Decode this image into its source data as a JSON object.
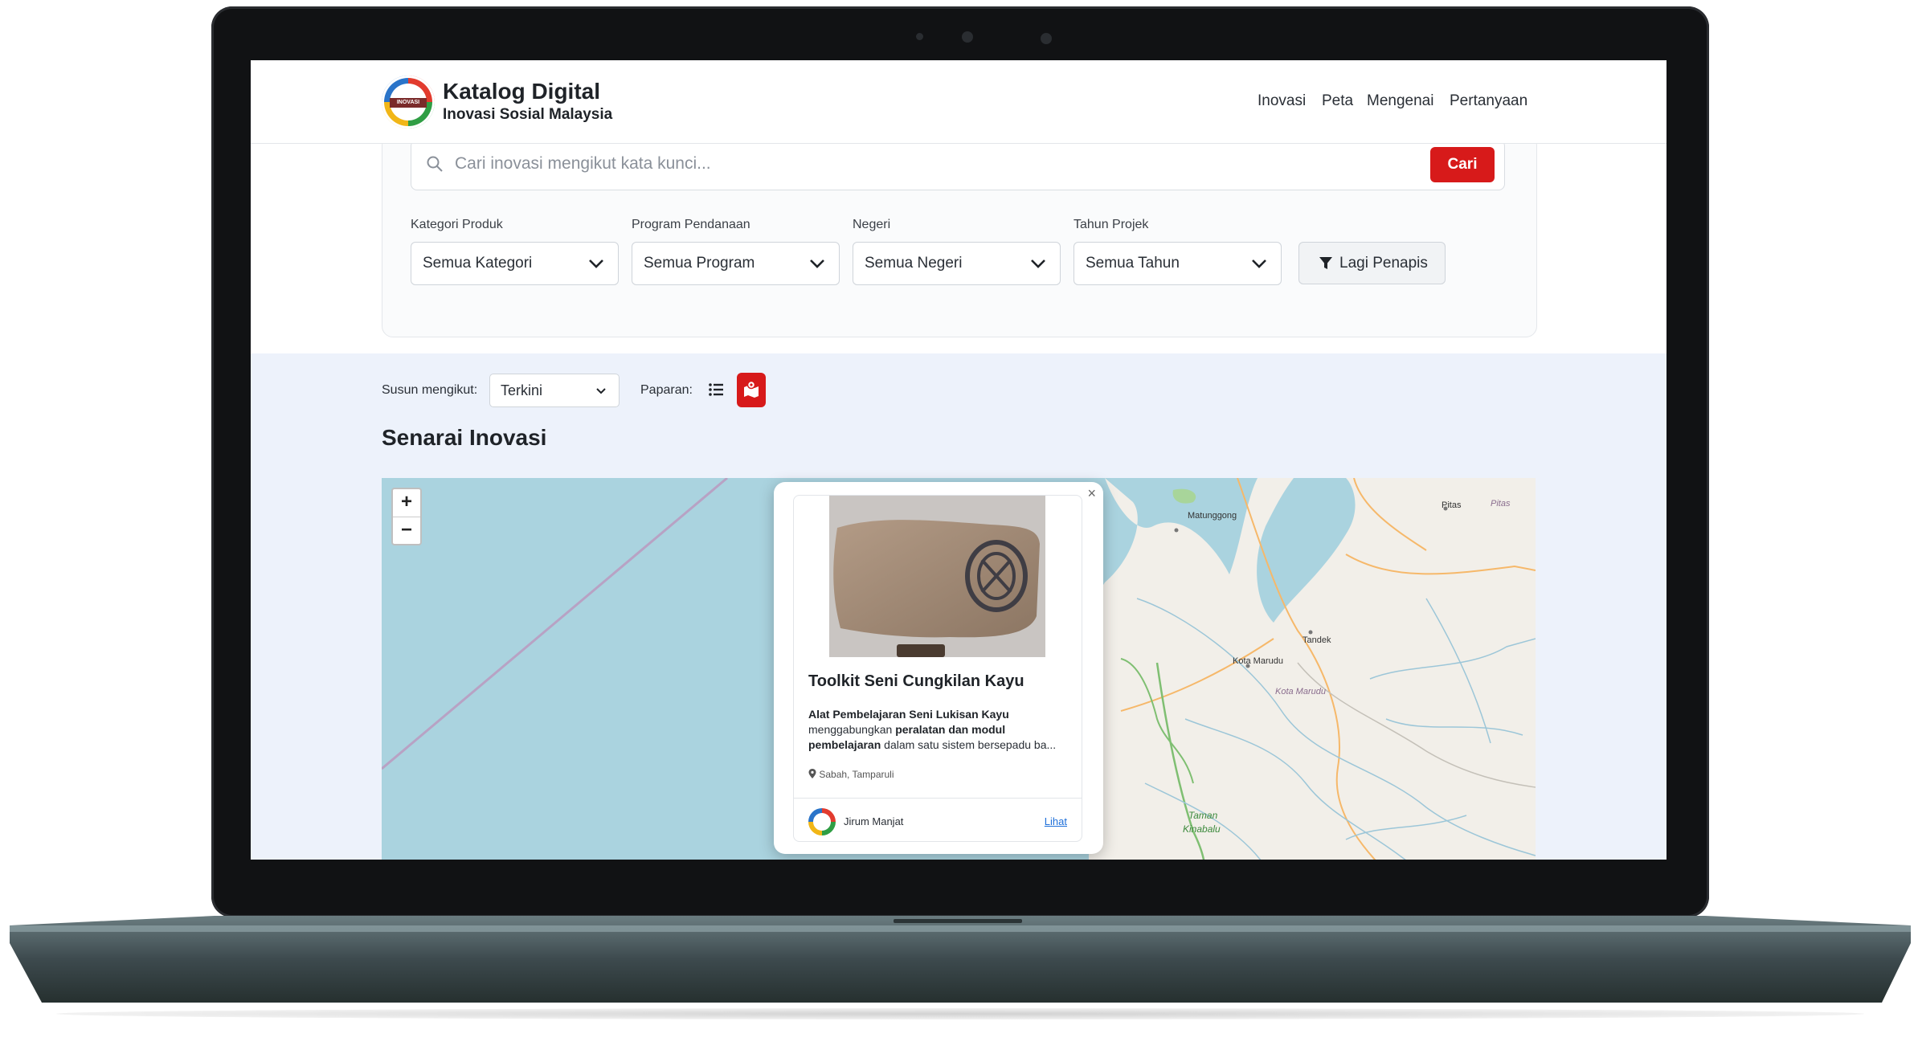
{
  "brand": {
    "title": "Katalog Digital",
    "subtitle": "Inovasi Sosial Malaysia",
    "logo_text": "INOVASI"
  },
  "nav": [
    "Inovasi",
    "Peta",
    "Mengenai",
    "Pertanyaan"
  ],
  "search": {
    "placeholder": "Cari inovasi mengikut kata kunci...",
    "button": "Cari"
  },
  "filters": [
    {
      "label": "Kategori Produk",
      "value": "Semua Kategori"
    },
    {
      "label": "Program Pendanaan",
      "value": "Semua Program"
    },
    {
      "label": "Negeri",
      "value": "Semua Negeri"
    },
    {
      "label": "Tahun Projek",
      "value": "Semua Tahun"
    }
  ],
  "more_filters": "Lagi Penapis",
  "sort": {
    "label": "Susun mengikut:",
    "value": "Terkini"
  },
  "view": {
    "label": "Paparan:"
  },
  "section_title": "Senarai Inovasi",
  "map": {
    "zoom_in": "+",
    "zoom_out": "−",
    "places": [
      "Matunggong",
      "Pitas",
      "Pitas",
      "Tandek",
      "Kota Marudu",
      "Kota Marudu",
      "Taman",
      "Kinabalu"
    ]
  },
  "popup": {
    "close": "×",
    "title": "Toolkit Seni Cungkilan Kayu",
    "desc_bold1": "Alat Pembelajaran Seni Lukisan Kayu",
    "desc_text1": " menggabungkan ",
    "desc_bold2": "peralatan dan modul pembelajaran",
    "desc_text2": " dalam satu sistem bersepadu ba...",
    "location": "Sabah, Tamparuli",
    "author": "Jirum Manjat",
    "link": "Lihat"
  },
  "colors": {
    "accent": "#d71a1a",
    "water": "#aad3df",
    "land": "#f2efe9",
    "listing_bg": "#edf2fb"
  },
  "icons": [
    "search-icon",
    "chevron-down-icon",
    "filter-icon",
    "list-icon",
    "map-icon",
    "close-icon",
    "location-pin-icon"
  ]
}
